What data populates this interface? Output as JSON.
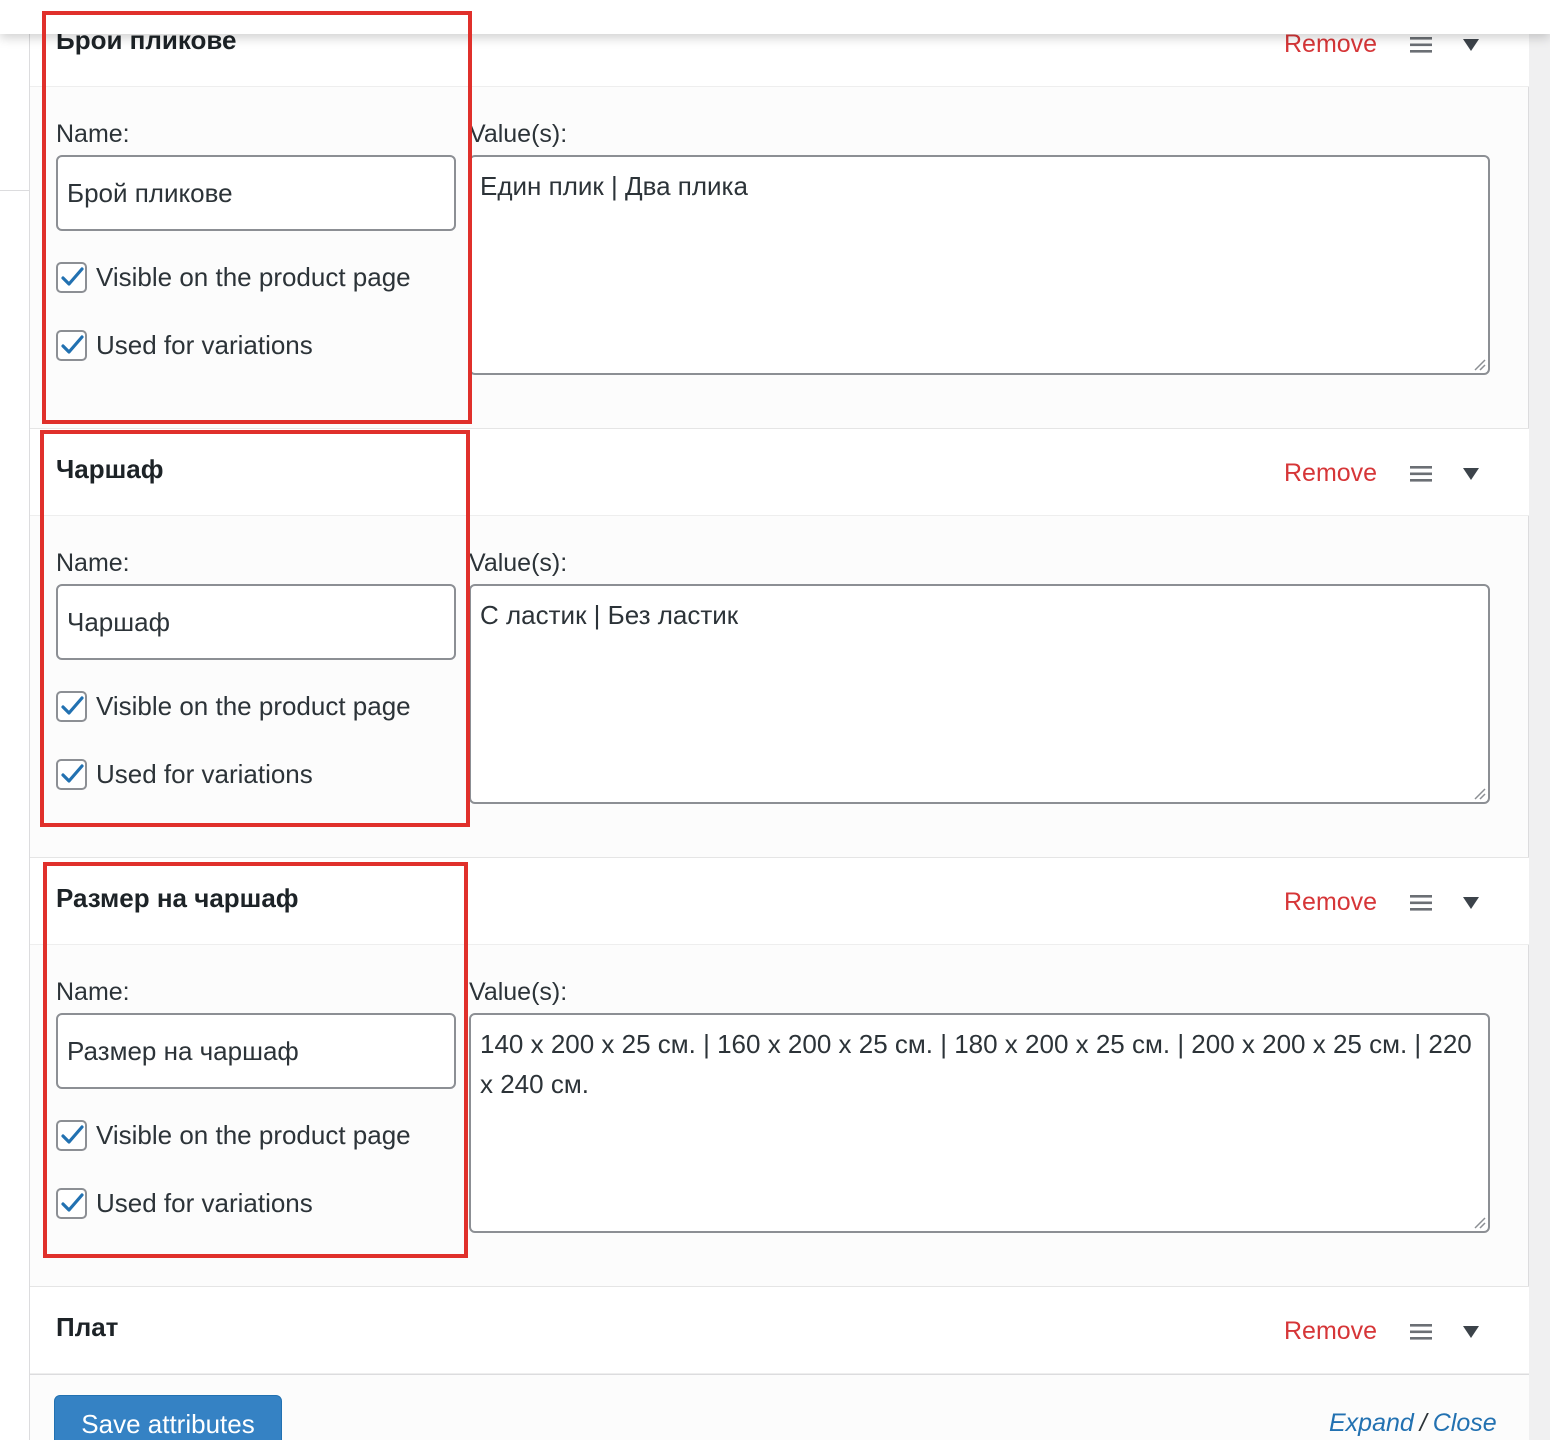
{
  "attributes": [
    {
      "title": "Брой пликове",
      "remove_label": "Remove",
      "name_label": "Name:",
      "values_label": "Value(s):",
      "name_value": "Брой пликове",
      "values_value": "Един плик | Два плика",
      "visible_label": "Visible on the product page",
      "visible_checked": true,
      "variations_label": "Used for variations",
      "variations_checked": true
    },
    {
      "title": "Чаршаф",
      "remove_label": "Remove",
      "name_label": "Name:",
      "values_label": "Value(s):",
      "name_value": "Чаршаф",
      "values_value": "С ластик | Без ластик",
      "visible_label": "Visible on the product page",
      "visible_checked": true,
      "variations_label": "Used for variations",
      "variations_checked": true
    },
    {
      "title": "Размер на чаршаф",
      "remove_label": "Remove",
      "name_label": "Name:",
      "values_label": "Value(s):",
      "name_value": "Размер на чаршаф",
      "values_value": "140 x 200 x 25 см. | 160 x 200 x 25 см. | 180 x 200 x 25 см. | 200 x 200 x 25 см. | 220 x 240 см.",
      "visible_label": "Visible on the product page",
      "visible_checked": true,
      "variations_label": "Used for variations",
      "variations_checked": true
    },
    {
      "title": "Плат",
      "remove_label": "Remove"
    }
  ],
  "footer": {
    "save_label": "Save attributes",
    "expand_label": "Expand",
    "separator": "/",
    "close_label": "Close"
  },
  "colors": {
    "remove": "#d63638",
    "button": "#3582c4",
    "link": "#2271b1",
    "check": "#2271b1",
    "highlight_box": "#e0302b"
  },
  "icons": [
    "sort-handle-icon",
    "toggle-arrow-icon",
    "checkmark-icon",
    "resize-grip-icon"
  ]
}
